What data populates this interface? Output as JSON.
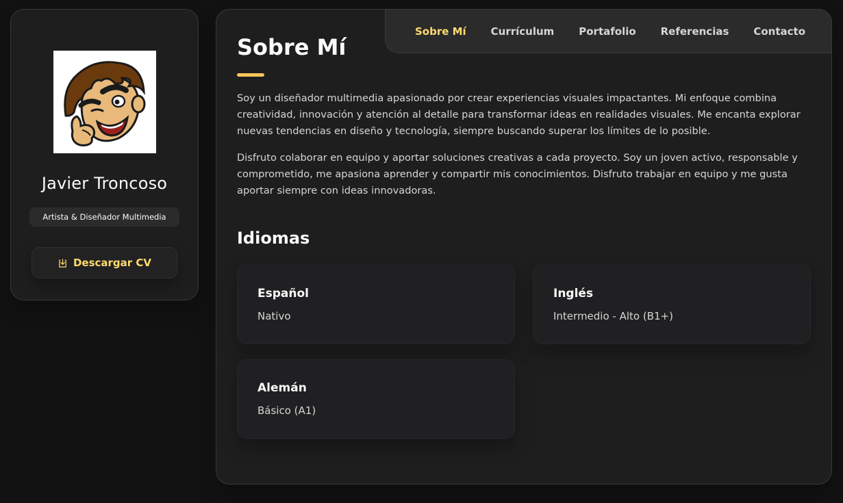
{
  "profile": {
    "name": "Javier Troncoso",
    "title": "Artista & Diseñador Multimedia",
    "cv_button_label": "Descargar CV"
  },
  "nav": {
    "items": [
      {
        "label": "Sobre Mí",
        "active": true
      },
      {
        "label": "Currículum",
        "active": false
      },
      {
        "label": "Portafolio",
        "active": false
      },
      {
        "label": "Referencias",
        "active": false
      },
      {
        "label": "Contacto",
        "active": false
      }
    ]
  },
  "about": {
    "title": "Sobre Mí",
    "paragraphs": [
      "Soy un diseñador multimedia apasionado por crear experiencias visuales impactantes. Mi enfoque combina creatividad, innovación y atención al detalle para transformar ideas en realidades visuales. Me encanta explorar nuevas tendencias en diseño y tecnología, siempre buscando superar los límites de lo posible.",
      "Disfruto colaborar en equipo y aportar soluciones creativas a cada proyecto. Soy un joven activo, responsable y comprometido, me apasiona aprender y compartir mis conocimientos. Disfruto trabajar en equipo y me gusta aportar siempre con ideas innovadoras."
    ]
  },
  "languages": {
    "title": "Idiomas",
    "items": [
      {
        "name": "Español",
        "level": "Nativo"
      },
      {
        "name": "Inglés",
        "level": "Intermedio - Alto (B1+)"
      },
      {
        "name": "Alemán",
        "level": "Básico (A1)"
      }
    ]
  },
  "colors": {
    "accent": "#ffdb70",
    "background": "#121212",
    "panel": "#1e1e1f"
  },
  "icons": {
    "cv_button": "download-icon"
  }
}
